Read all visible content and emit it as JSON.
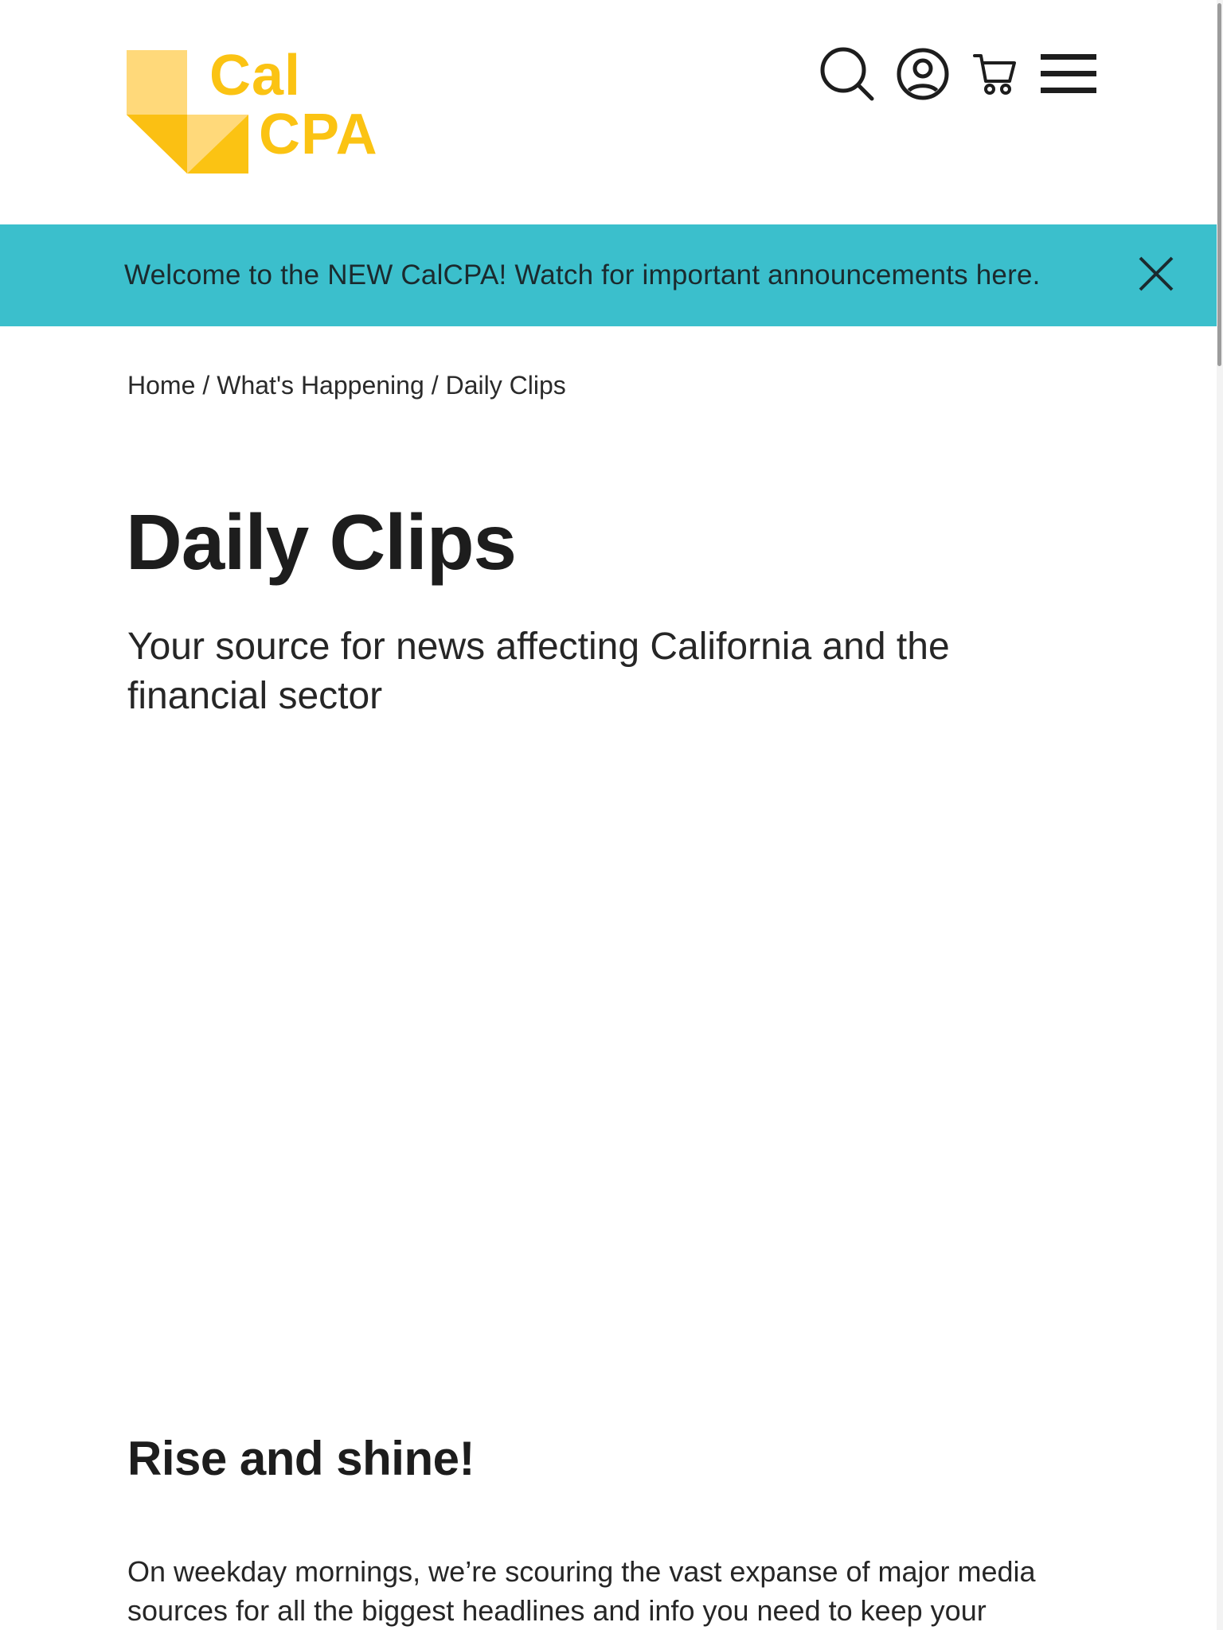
{
  "header": {
    "logo": {
      "line1": "Cal",
      "line2": "CPA",
      "color_primary": "#fbc313",
      "color_light": "#ffd97a"
    },
    "icons": [
      "search-icon",
      "user-account-icon",
      "shopping-cart-icon",
      "hamburger-menu-icon"
    ]
  },
  "banner": {
    "text": "Welcome to the NEW CalCPA! Watch for important announcements here.",
    "background": "#3bbfcc"
  },
  "breadcrumb": {
    "items": [
      "Home",
      "What's Happening",
      "Daily Clips"
    ],
    "separator": "/"
  },
  "main": {
    "title": "Daily Clips",
    "subtitle": "Your source for news affecting California and the financial sector",
    "section_title": "Rise and shine!",
    "body": "On weekday mornings, we’re scouring the vast expanse of major media sources for all the biggest headlines and info you need to keep your"
  }
}
